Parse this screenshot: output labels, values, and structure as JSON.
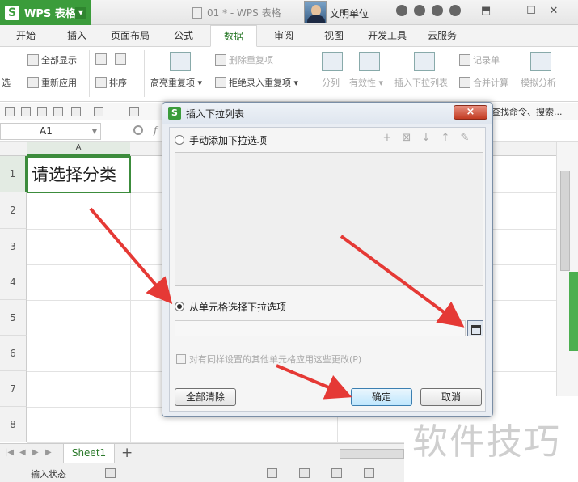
{
  "titlebar": {
    "app_name": "WPS 表格",
    "doc_title": "01 * - WPS 表格",
    "user_name": "文明单位"
  },
  "tabs": [
    "开始",
    "插入",
    "页面布局",
    "公式",
    "数据",
    "审阅",
    "视图",
    "开发工具",
    "云服务"
  ],
  "active_tab": "数据",
  "ribbon": {
    "filter_label": "选",
    "show_all": "全部显示",
    "reapply": "重新应用",
    "sort": "排序",
    "highlight_dup": "高亮重复项",
    "delete_dup": "删除重复项",
    "reject_dup": "拒绝录入重复项",
    "split": "分列",
    "validity": "有效性",
    "insert_dropdown": "插入下拉列表",
    "record_sheet": "记录单",
    "merge_calc": "合并计算",
    "simulate": "模拟分析"
  },
  "quick_toolbar": {
    "search": "查找命令、搜索..."
  },
  "formula_bar": {
    "name_box": "A1",
    "fx": "f"
  },
  "grid": {
    "col_header": "A",
    "rows": [
      "1",
      "2",
      "3",
      "4",
      "5",
      "6",
      "7",
      "8"
    ],
    "cell_a1": "请选择分类"
  },
  "sheets": {
    "tab": "Sheet1",
    "add": "+"
  },
  "status": {
    "text": "输入状态"
  },
  "dialog": {
    "title": "插入下拉列表",
    "close": "×",
    "option_manual": "手动添加下拉选项",
    "option_from_cells": "从单元格选择下拉选项",
    "apply_others": "对有同样设置的其他单元格应用这些更改(P)",
    "clear_all": "全部清除",
    "ok": "确定",
    "cancel": "取消"
  },
  "watermark": "软件技巧"
}
